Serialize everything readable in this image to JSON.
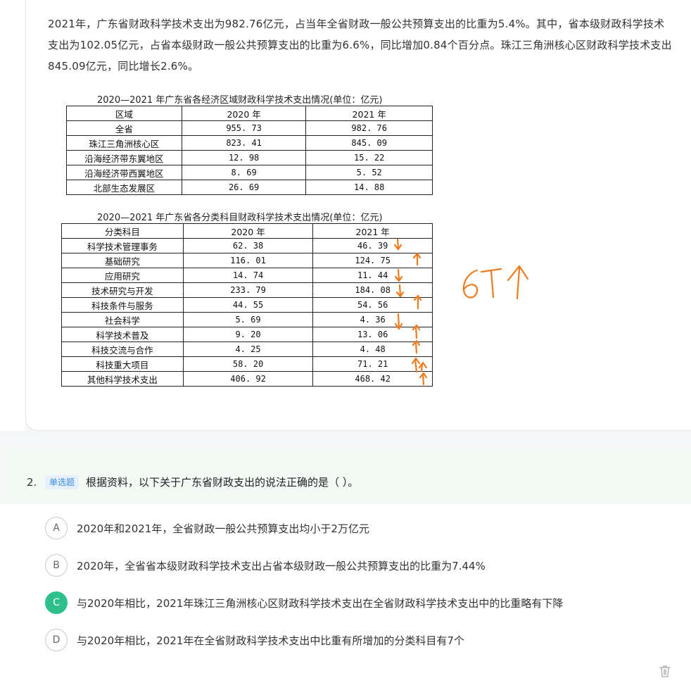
{
  "material": {
    "paragraph": "2021年，广东省财政科学技术支出为982.76亿元，占当年全省财政一般公共预算支出的比重为5.4%。其中，省本级财政科学技术支出为102.05亿元，占省本级财政一般公共预算支出的比重为6.6%，同比增加0.84个百分点。珠江三角洲核心区财政科学技术支出845.09亿元，同比增长2.6%。"
  },
  "table1": {
    "title": "2020—2021 年广东省各经济区域财政科学技术支出情况(单位：亿元)",
    "headers": [
      "区域",
      "2020 年",
      "2021 年"
    ],
    "rows": [
      [
        "全省",
        "955. 73",
        "982. 76"
      ],
      [
        "珠江三角洲核心区",
        "823. 41",
        "845. 09"
      ],
      [
        "沿海经济带东翼地区",
        "12. 98",
        "15. 22"
      ],
      [
        "沿海经济带西翼地区",
        "8. 69",
        "5. 52"
      ],
      [
        "北部生态发展区",
        "26. 69",
        "14. 88"
      ]
    ]
  },
  "table2": {
    "title": "2020—2021 年广东省各分类科目财政科学技术支出情况(单位：亿元)",
    "headers": [
      "分类科目",
      "2020 年",
      "2021 年"
    ],
    "rows": [
      [
        "科学技术管理事务",
        "62. 38",
        "46. 39"
      ],
      [
        "基础研究",
        "116. 01",
        "124. 75"
      ],
      [
        "应用研究",
        "14. 74",
        "11. 44"
      ],
      [
        "技术研究与开发",
        "233. 79",
        "184. 08"
      ],
      [
        "科技条件与服务",
        "44. 55",
        "54. 56"
      ],
      [
        "社会科学",
        "5. 69",
        "4. 36"
      ],
      [
        "科学技术普及",
        "9. 20",
        "13. 06"
      ],
      [
        "科技交流与合作",
        "4. 25",
        "4. 48"
      ],
      [
        "科技重大项目",
        "58. 20",
        "71. 21"
      ],
      [
        "其他科学技术支出",
        "406. 92",
        "468. 42"
      ]
    ]
  },
  "handwriting": {
    "color": "#f07a1e",
    "note": "6个↑"
  },
  "question": {
    "number": "2.",
    "type_tag": "单选题",
    "text": "根据资料，以下关于广东省财政支出的说法正确的是（ ）。",
    "options": [
      {
        "letter": "A",
        "text": "2020年和2021年，全省财政一般公共预算支出均小于2万亿元",
        "selected": false
      },
      {
        "letter": "B",
        "text": "2020年，全省省本级财政科学技术支出占省本级财政一般公共预算支出的比重为7.44%",
        "selected": false
      },
      {
        "letter": "C",
        "text": "与2020年相比，2021年珠江三角洲核心区财政科学技术支出在全省财政科学技术支出中的比重略有下降",
        "selected": true
      },
      {
        "letter": "D",
        "text": "与2020年相比，2021年在全省财政科学技术支出中比重有所增加的分类科目有7个",
        "selected": false
      }
    ]
  },
  "colors": {
    "selected_green": "#2dc08d",
    "tag_blue": "#3a8ee6",
    "header_bg": "#f2faf6"
  }
}
